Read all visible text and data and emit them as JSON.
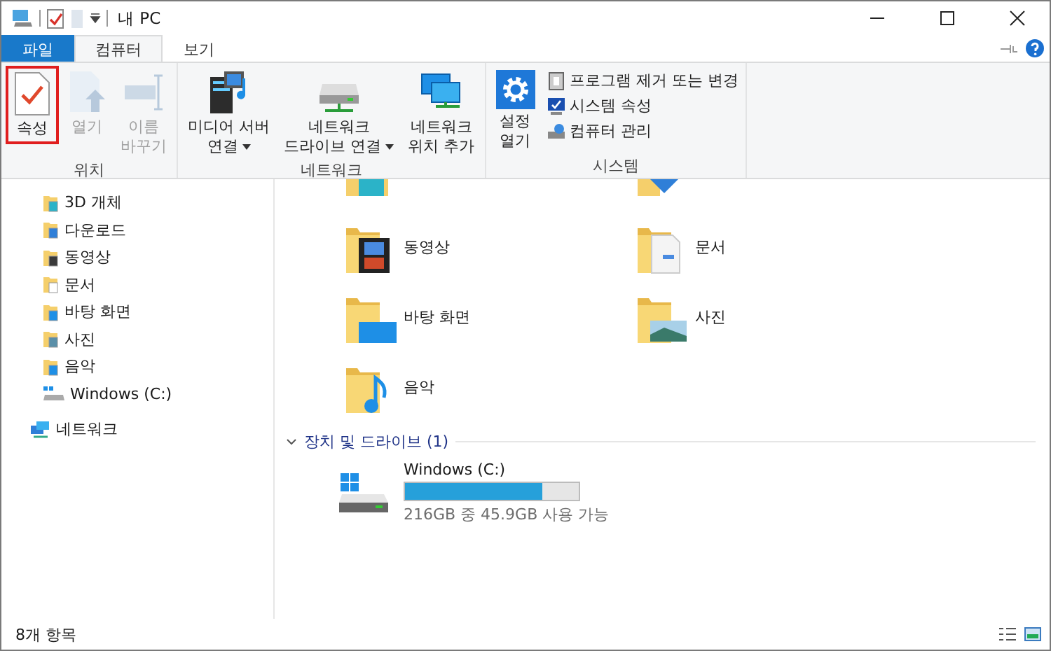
{
  "window": {
    "title": "내 PC"
  },
  "tabs": [
    {
      "label": "파일",
      "kind": "file",
      "selected": false
    },
    {
      "label": "컴퓨터",
      "kind": "tab",
      "selected": true
    },
    {
      "label": "보기",
      "kind": "tab",
      "selected": false
    }
  ],
  "ribbon": {
    "groups": [
      {
        "label": "위치",
        "commands": [
          {
            "kind": "properties",
            "lines": [
              "속성"
            ],
            "disabled": false,
            "highlighted": true,
            "dropdown": false
          },
          {
            "kind": "open",
            "lines": [
              "열기"
            ],
            "disabled": true,
            "highlighted": false,
            "dropdown": false
          },
          {
            "kind": "rename",
            "lines": [
              "이름",
              "바꾸기"
            ],
            "disabled": true,
            "highlighted": false,
            "dropdown": false
          }
        ]
      },
      {
        "label": "네트워크",
        "commands": [
          {
            "kind": "media",
            "lines": [
              "미디어 서버",
              "연결"
            ],
            "disabled": false,
            "highlighted": false,
            "dropdown": true
          },
          {
            "kind": "drive",
            "lines": [
              "네트워크",
              "드라이브 연결"
            ],
            "disabled": false,
            "highlighted": false,
            "dropdown": true
          },
          {
            "kind": "location",
            "lines": [
              "네트워크",
              "위치 추가"
            ],
            "disabled": false,
            "highlighted": false,
            "dropdown": false
          }
        ]
      },
      {
        "label": "시스템",
        "commands": [
          {
            "kind": "settings",
            "lines": [
              "설정",
              "열기"
            ],
            "disabled": false,
            "highlighted": false,
            "dropdown": false
          }
        ],
        "small_commands": [
          {
            "kind": "uninstall",
            "label": "프로그램 제거 또는 변경"
          },
          {
            "kind": "sysprops",
            "label": "시스템 속성"
          },
          {
            "kind": "manage",
            "label": "컴퓨터 관리"
          }
        ]
      }
    ]
  },
  "sidebar": {
    "nested_items": [
      {
        "label": "3D 개체",
        "kind": "objects3d"
      },
      {
        "label": "다운로드",
        "kind": "downloads"
      },
      {
        "label": "동영상",
        "kind": "videos"
      },
      {
        "label": "문서",
        "kind": "documents"
      },
      {
        "label": "바탕 화면",
        "kind": "desktop"
      },
      {
        "label": "사진",
        "kind": "pictures"
      },
      {
        "label": "음악",
        "kind": "music"
      },
      {
        "label": "Windows (C:)",
        "kind": "drive"
      }
    ],
    "items": [
      {
        "label": "네트워크",
        "kind": "network"
      }
    ]
  },
  "folders": [
    {
      "label": "동영상",
      "kind": "videos"
    },
    {
      "label": "문서",
      "kind": "documents"
    },
    {
      "label": "바탕 화면",
      "kind": "desktop"
    },
    {
      "label": "사진",
      "kind": "pictures"
    },
    {
      "label": "음악",
      "kind": "music"
    }
  ],
  "devices": {
    "header": "장치 및 드라이브 (1)",
    "expanded": true,
    "drives": [
      {
        "name": "Windows (C:)",
        "level": 0.79,
        "caption": "216GB 중 45.9GB 사용 가능"
      }
    ]
  },
  "status_bar": {
    "text": "8개 항목"
  }
}
